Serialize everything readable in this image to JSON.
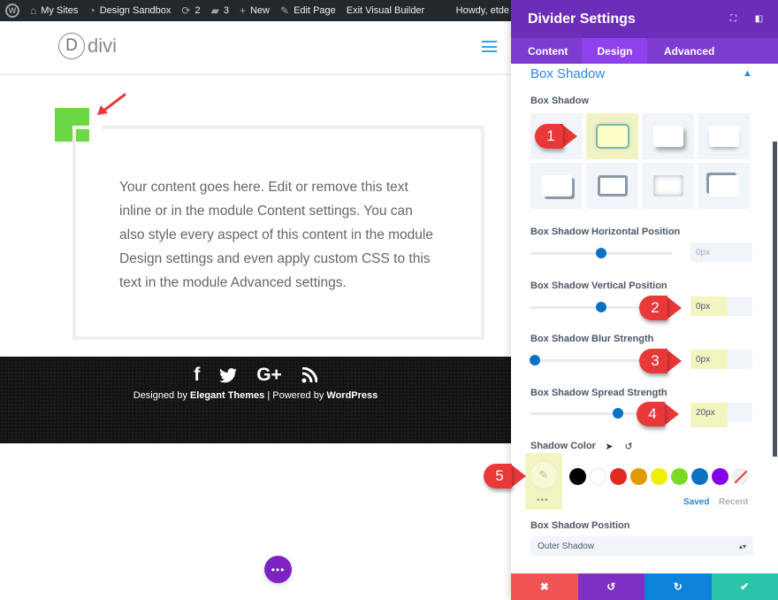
{
  "admin_bar": {
    "items": [
      {
        "icon": "wordpress-icon",
        "label": ""
      },
      {
        "icon": "my-sites-icon",
        "label": "My Sites"
      },
      {
        "icon": "dashboard-icon",
        "label": "Design Sandbox"
      },
      {
        "icon": "updates-icon",
        "label": "2"
      },
      {
        "icon": "comments-icon",
        "label": "3"
      },
      {
        "icon": "plus-icon",
        "label": "New"
      },
      {
        "icon": "pencil-icon",
        "label": "Edit Page"
      },
      {
        "icon": "",
        "label": "Exit Visual Builder"
      }
    ],
    "howdy": "Howdy, etde"
  },
  "site": {
    "logo_letter": "D",
    "logo_text": "divi",
    "body_text": "Your content goes here. Edit or remove this text inline or in the module Content settings. You can also style every aspect of this content in the module Design settings and even apply custom CSS to this text in the module Advanced settings.",
    "divider_color": "#6bd845",
    "footer": {
      "social": [
        "f",
        "🐦",
        "G+",
        "rss"
      ],
      "credit_prefix": "Designed by ",
      "credit_theme": "Elegant Themes",
      "credit_mid": " | Powered by ",
      "credit_platform": "WordPress"
    },
    "more_button": "•••"
  },
  "panel": {
    "title": "Divider Settings",
    "tabs": [
      {
        "label": "Content",
        "active": false
      },
      {
        "label": "Design",
        "active": true
      },
      {
        "label": "Advanced",
        "active": false
      }
    ],
    "section_title": "Box Shadow",
    "box_shadow_label": "Box Shadow",
    "presets_count": 8,
    "selected_preset": 2,
    "horizontal": {
      "label": "Box Shadow Horizontal Position",
      "value": "0px",
      "slider_fraction": 0.5
    },
    "vertical": {
      "label": "Box Shadow Vertical Position",
      "value": "0px",
      "slider_fraction": 0.5
    },
    "blur": {
      "label": "Box Shadow Blur Strength",
      "value": "0px",
      "slider_fraction": 0.03
    },
    "spread": {
      "label": "Box Shadow Spread Strength",
      "value": "20px",
      "slider_fraction": 0.62
    },
    "shadow_color_label": "Shadow Color",
    "swatches": [
      "#000000",
      "#ffffff",
      "#e02b20",
      "#e09900",
      "#edf000",
      "#7cda24",
      "#0c71c3",
      "#8300e9",
      "none"
    ],
    "saved_label": "Saved",
    "recent_label": "Recent",
    "position_label": "Box Shadow Position",
    "position_value": "Outer Shadow",
    "markers": [
      "1",
      "2",
      "3",
      "4",
      "5"
    ],
    "footer_icons": {
      "cancel": "✖",
      "undo": "↺",
      "redo": "↻",
      "save": "✔"
    }
  }
}
